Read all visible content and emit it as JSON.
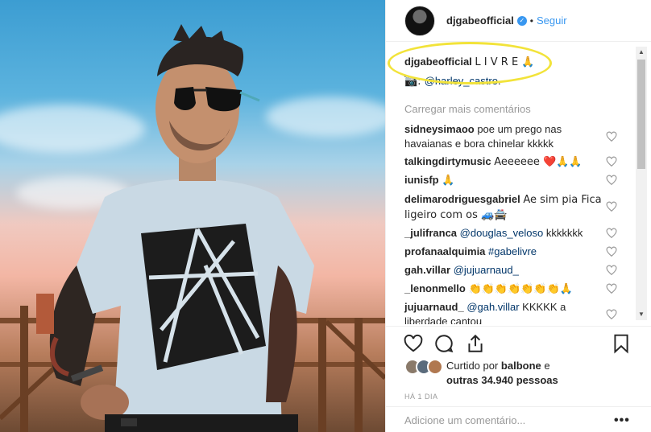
{
  "post": {
    "author": "djgabeofficial",
    "separator": "•",
    "follow_label": "Seguir",
    "verified_glyph": "✓"
  },
  "caption": {
    "user": "djgabeofficial",
    "text": "L I V R E 🙏",
    "line2": "_",
    "credit_prefix": "📷: ",
    "credit_mention": "@harley_castro",
    "credit_suffix": "."
  },
  "load_more": "Carregar mais comentários",
  "comments": [
    {
      "user": "sidneysimaoo",
      "text": "poe um prego nas havaianas e bora chinelar kkkkk"
    },
    {
      "user": "talkingdirtymusic",
      "text": "Aeeeeee ❤️🙏🙏"
    },
    {
      "user": "iunisfp",
      "text": "🙏"
    },
    {
      "user": "delimarodriguesgabriel",
      "text": "Ae sim pia Fica ligeiro com os 🚙🚔"
    },
    {
      "user": "_julifranca",
      "mention": "@douglas_veloso",
      "text": "kkkkkkk"
    },
    {
      "user": "profanaalquimia",
      "mention": "#gabelivre",
      "text": ""
    },
    {
      "user": "gah.villar",
      "mention": "@jujuarnaud_",
      "text": ""
    },
    {
      "user": "_lenonmello",
      "text": "👏👏👏👏👏👏👏🙏"
    },
    {
      "user": "jujuarnaud_",
      "mention": "@gah.villar",
      "text": "KKKKK a liberdade cantou"
    }
  ],
  "likes": {
    "prefix": "Curtido por ",
    "user": "balbone",
    "suffix": " e",
    "line2": "outras 34.940 pessoas"
  },
  "time": "HÁ 1 DIA",
  "add_comment": {
    "placeholder": "Adicione um comentário...",
    "more": "•••"
  },
  "icons": [
    "heart-icon",
    "comment-icon",
    "share-icon",
    "bookmark-icon"
  ],
  "colors": {
    "accent": "#3897f0",
    "highlight": "#f2e33a",
    "mention": "#003569",
    "muted": "#999999"
  }
}
